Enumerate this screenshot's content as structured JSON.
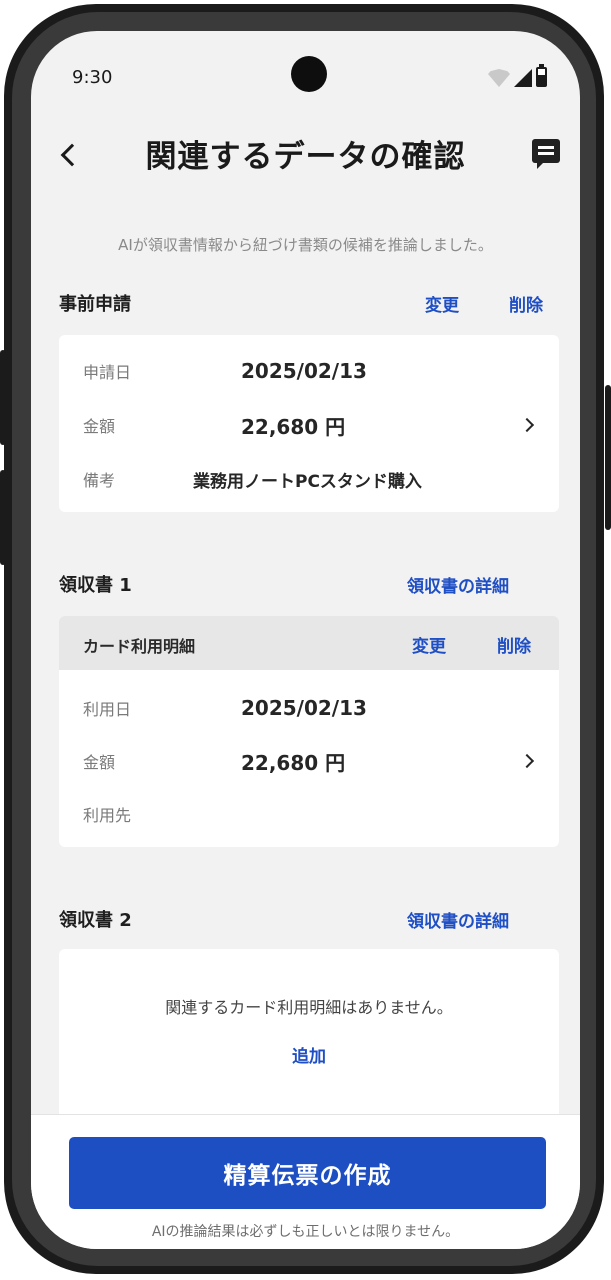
{
  "status_bar": {
    "time": "9:30"
  },
  "header": {
    "title": "関連するデータの確認"
  },
  "ai_note": "AIが領収書情報から紐づけ書類の候補を推論しました。",
  "pre_application": {
    "title": "事前申請",
    "change_label": "変更",
    "delete_label": "削除",
    "rows": [
      {
        "label": "申請日",
        "value": "2025/02/13"
      },
      {
        "label": "金額",
        "value": "22,680 円"
      },
      {
        "label": "備考",
        "value": "業務用ノートPCスタンド購入"
      }
    ]
  },
  "receipt1": {
    "title": "領収書 1",
    "detail_link": "領収書の詳細",
    "card_header": "カード利用明細",
    "change_label": "変更",
    "delete_label": "削除",
    "rows": [
      {
        "label": "利用日",
        "value": "2025/02/13"
      },
      {
        "label": "金額",
        "value": "22,680 円"
      },
      {
        "label": "利用先",
        "value": ""
      }
    ]
  },
  "receipt2": {
    "title": "領収書 2",
    "detail_link": "領収書の詳細",
    "empty_message": "関連するカード利用明細はありません。",
    "add_label": "追加"
  },
  "footer": {
    "primary_button": "精算伝票の作成",
    "disclaimer": "AIの推論結果は必ずしも正しいとは限りません。"
  },
  "colors": {
    "accent": "#1e4fc2",
    "link": "#1f4fc4",
    "background": "#f2f2f2"
  },
  "icons": [
    "back-chevron",
    "message",
    "wifi",
    "signal",
    "battery",
    "chevron-right"
  ]
}
